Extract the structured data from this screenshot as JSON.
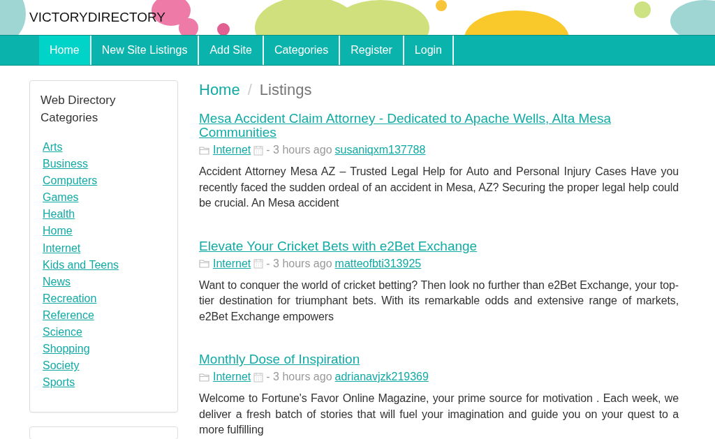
{
  "site": {
    "title": "VICTORYDIRECTORY"
  },
  "nav": [
    {
      "label": "Home",
      "selected": true
    },
    {
      "label": "New Site Listings",
      "selected": false
    },
    {
      "label": "Add Site",
      "selected": false
    },
    {
      "label": "Categories",
      "selected": false
    },
    {
      "label": "Register",
      "selected": false
    },
    {
      "label": "Login",
      "selected": false
    }
  ],
  "sidebar": {
    "title": "Web Directory Categories",
    "items": [
      "Arts",
      "Business",
      "Computers",
      "Games",
      "Health",
      "Home",
      "Internet",
      "Kids and Teens",
      "News",
      "Recreation",
      "Reference",
      "Science",
      "Shopping",
      "Society",
      "Sports"
    ]
  },
  "breadcrumb": {
    "items": [
      "Home",
      "Listings"
    ],
    "separator": "/"
  },
  "listings": [
    {
      "title": "Mesa Accident Claim Attorney - Dedicated to Apache Wells, Alta Mesa Communities",
      "category": "Internet",
      "time": "- 3 hours ago",
      "user": "susaniqxm137788",
      "text": "Accident Attorney Mesa AZ – Trusted Legal Help for Auto and Personal Injury Cases Have you recently faced the sudden ordeal of an accident in Mesa, AZ? Securing the proper legal help could be crucial. An Mesa accident"
    },
    {
      "title": "Elevate Your Cricket Bets with e2Bet Exchange",
      "category": "Internet",
      "time": "- 3 hours ago",
      "user": "matteofbti313925",
      "text": "Want to conquer the world of cricket betting? Then look no further than e2Bet Exchange, your top-tier destination for triumphant bets. With its remarkable odds and extensive range of markets, e2Bet Exchange empowers"
    },
    {
      "title": "Monthly Dose of Inspiration",
      "category": "Internet",
      "time": "- 3 hours ago",
      "user": "adrianavjzk219369",
      "text": "Welcome to Fortune's Favor Online Magazine, your prime source for motivation . Each week, we deliver a fresh batch of stories that will fuel your imagination and guide you on your quest to a more fulfilling"
    }
  ]
}
